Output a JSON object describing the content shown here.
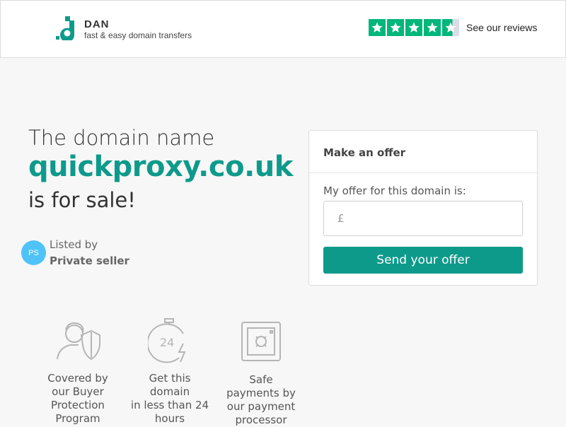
{
  "header": {
    "brand_name": "DAN",
    "brand_tagline": "fast & easy domain transfers",
    "reviews_link": "See our reviews",
    "rating_stars": 4.5,
    "brand_color": "#0e9a8b",
    "star_color": "#00b67a"
  },
  "hero": {
    "title_pre": "The domain name",
    "domain": "quickproxy.co.uk",
    "title_post": "is for sale!"
  },
  "seller": {
    "avatar_initials": "PS",
    "listed_by_label": "Listed by",
    "name": "Private seller"
  },
  "features": [
    {
      "icon": "buyer-protection-icon",
      "line1": "Covered by",
      "line2": "our Buyer",
      "line3": "Protection",
      "line4": "Program"
    },
    {
      "icon": "stopwatch-24-icon",
      "line1": "Get this",
      "line2": "domain",
      "line3": "in less than 24",
      "line4": "hours"
    },
    {
      "icon": "safe-icon",
      "line1": "Safe",
      "line2": "payments by",
      "line3": "our payment",
      "line4": "processor"
    }
  ],
  "offer": {
    "heading": "Make an offer",
    "label": "My offer for this domain is:",
    "currency_symbol": "£",
    "input_value": "",
    "send_button": "Send your offer"
  }
}
